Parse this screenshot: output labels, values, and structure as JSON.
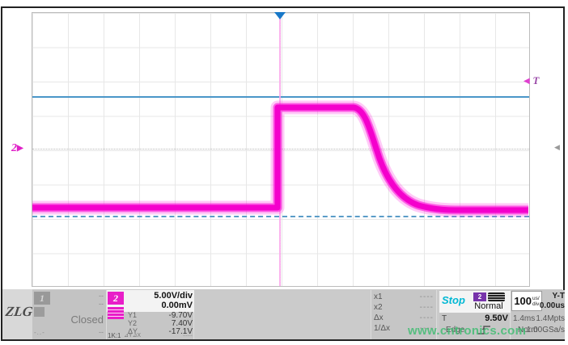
{
  "watermark": "www.cntronics.com",
  "logo": {
    "text": "ZLG",
    "reg": "®"
  },
  "graticule": {
    "ch2_marker": "2",
    "trigger_marker": "T",
    "arrow_left": "◀",
    "arrow_right": "▶"
  },
  "channel1": {
    "id": "1",
    "status": "Closed",
    "row1": "--",
    "row2": "--",
    "bottom_left": "-..-",
    "bottom_right": "--"
  },
  "channel2": {
    "id": "2",
    "scale": "5.00V/div",
    "offset": "0.00mV",
    "rows": [
      {
        "label": "Y1",
        "value": "-9.70V"
      },
      {
        "label": "Y2",
        "value": "7.40V"
      },
      {
        "label": "ΔY",
        "value": "-17.1V"
      }
    ],
    "probe": "1K:1",
    "probe_icons": "⊿Y⊿X",
    "dash": "----"
  },
  "cursors": {
    "rows": [
      {
        "label": "x1",
        "value": "----"
      },
      {
        "label": "x2",
        "value": "----"
      },
      {
        "label": "Δx",
        "value": "----"
      },
      {
        "label": "1/Δx",
        "value": "----"
      }
    ]
  },
  "trigger": {
    "state": "Stop",
    "source": "2",
    "mode": "Normal",
    "level_label": "T",
    "level": "9.50V",
    "type": "Edge"
  },
  "timebase": {
    "scale": "100",
    "unit_top": "us/",
    "unit_bottom": "div",
    "mode": "Y-T",
    "delay": "0.00us",
    "window": "1.4ms",
    "depth": "1.4Mpts",
    "acq": "Norm",
    "rate": "1.00GSa/s"
  },
  "colors": {
    "waveform": "#f400cc",
    "cursor_line": "#4a96c8",
    "stop": "#00b8d4",
    "trigger_source_bg": "#7733aa",
    "channel2": "#e81ec8",
    "watermark": "#3abc6e"
  }
}
